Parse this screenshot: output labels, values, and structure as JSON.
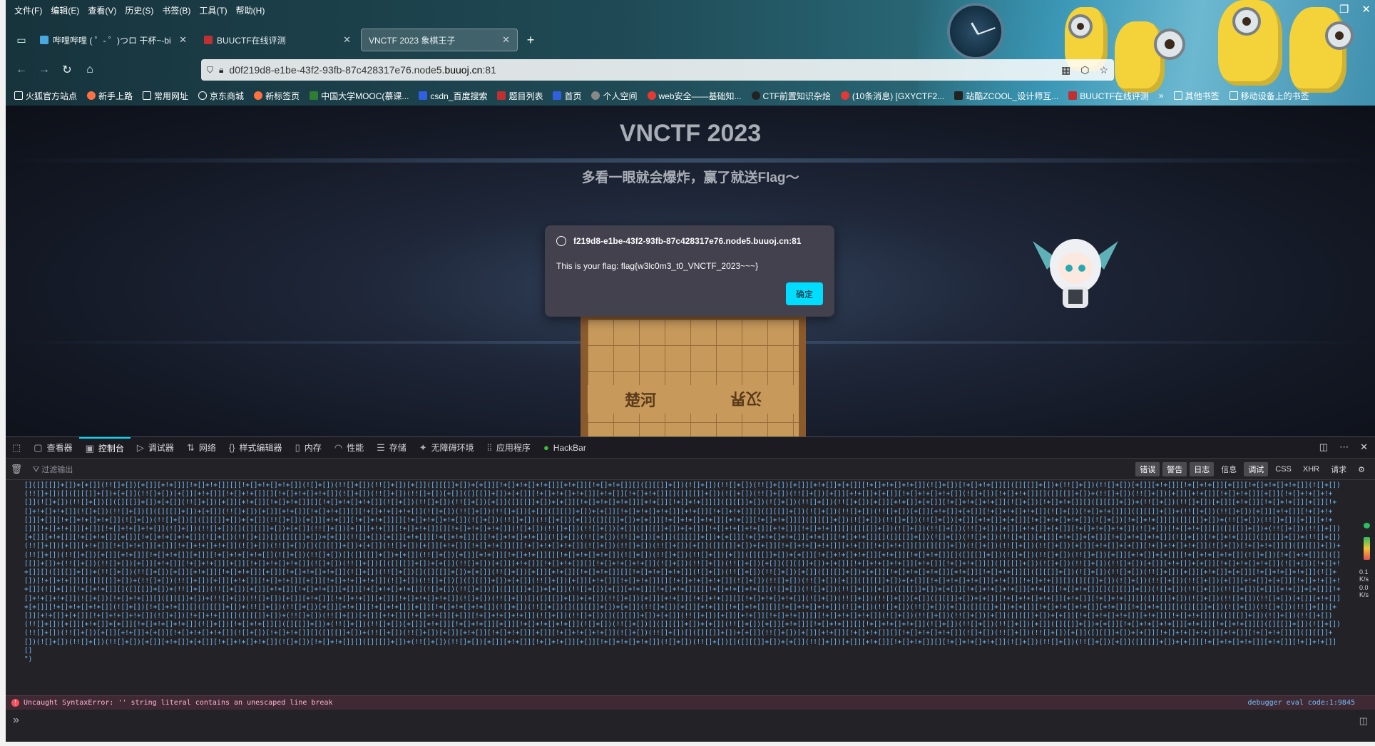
{
  "menu": [
    "文件(F)",
    "编辑(E)",
    "查看(V)",
    "历史(S)",
    "书签(B)",
    "工具(T)",
    "帮助(H)"
  ],
  "tabs": [
    {
      "label": "哔哩哔哩 ( ゜- ゜)つロ 干杯~-bi",
      "color": "#4aa8e0"
    },
    {
      "label": "BUUCTF在线评测",
      "color": "#c03030"
    },
    {
      "label": "VNCTF 2023 象棋王子",
      "color": "#ffffff"
    }
  ],
  "url": {
    "prefix": "d0f219d8-e1be-43f2-93fb-87c428317e76.node5.",
    "domain": "buuoj.cn",
    "port": ":81"
  },
  "bookmarks": [
    {
      "label": "火狐官方站点",
      "color": "#f0f0f0"
    },
    {
      "label": "新手上路",
      "color": "#ff7043"
    },
    {
      "label": "常用网址",
      "color": "#f0f0f0"
    },
    {
      "label": "京东商城",
      "color": "#f0f0f0"
    },
    {
      "label": "新标签页",
      "color": "#ff7043"
    },
    {
      "label": "中国大学MOOC(慕课...",
      "color": "#2e7d32"
    },
    {
      "label": "csdn_百度搜索",
      "color": "#3060e0"
    },
    {
      "label": "题目列表",
      "color": "#c03030"
    },
    {
      "label": "首页",
      "color": "#3060e0"
    },
    {
      "label": "个人空间",
      "color": "#888888"
    },
    {
      "label": "web安全——基础知...",
      "color": "#e53935"
    },
    {
      "label": "CTF前置知识杂烩",
      "color": "#222222"
    },
    {
      "label": "(10条消息) [GXYCTF2...",
      "color": "#e53935"
    },
    {
      "label": "站酷ZCOOL_设计师互...",
      "color": "#222222"
    },
    {
      "label": "BUUCTF在线评测",
      "color": "#c03030"
    }
  ],
  "bookmarks_right": [
    "其他书签",
    "移动设备上的书签"
  ],
  "page": {
    "title": "VNCTF 2023",
    "subtitle": "多看一眼就会爆炸，赢了就送Flag～",
    "river_left": "楚河",
    "river_right": "汉界"
  },
  "dialog": {
    "origin": "f219d8-e1be-43f2-93fb-87c428317e76.node5.buuoj.cn:81",
    "message": "This is your flag: flag{w3lc0m3_t0_VNCTF_2023~~~}",
    "ok": "确定"
  },
  "devtools": {
    "tabs": [
      "查看器",
      "控制台",
      "调试器",
      "网络",
      "样式编辑器",
      "内存",
      "性能",
      "存储",
      "无障碍环境",
      "应用程序",
      "HackBar"
    ],
    "filter_placeholder": "过滤输出",
    "levels": [
      "错误",
      "警告",
      "日志",
      "信息",
      "调试",
      "CSS",
      "XHR",
      "请求"
    ],
    "error": "Uncaught SyntaxError: '' string literal contains an unescaped line break",
    "error_location": "debugger eval code:1:9845",
    "output_end": "\")"
  },
  "gauge": {
    "up": "0.1",
    "down": "0.0",
    "unit": "K/s"
  }
}
